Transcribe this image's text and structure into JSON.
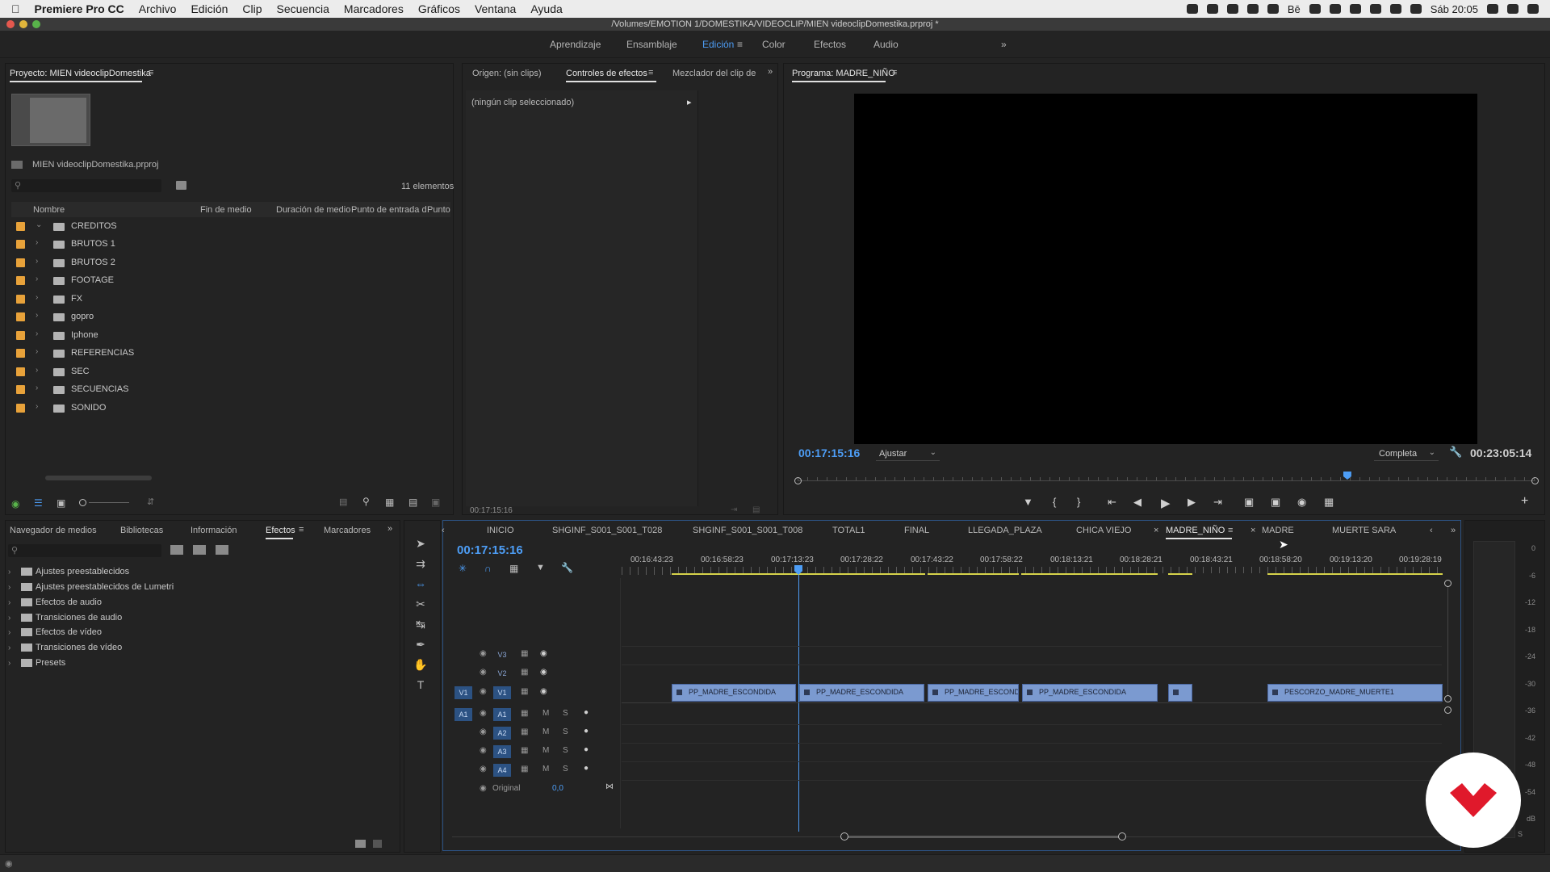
{
  "menubar": {
    "items": [
      "Premiere Pro CC",
      "Archivo",
      "Edición",
      "Clip",
      "Secuencia",
      "Marcadores",
      "Gráficos",
      "Ventana",
      "Ayuda"
    ],
    "clock": "Sáb 20:05",
    "behance": "Bē"
  },
  "window": {
    "title": "/Volumes/EMOTION 1/DOMESTIKA/VIDEOCLIP/MIEN videoclipDomestika.prproj *"
  },
  "workspaces": {
    "items": [
      "Aprendizaje",
      "Ensamblaje",
      "Edición",
      "Color",
      "Efectos",
      "Audio"
    ],
    "active": "Edición",
    "more": "»"
  },
  "project": {
    "title": "Proyecto: MIEN videoclipDomestika",
    "file": "MIEN videoclipDomestika.prproj",
    "count": "11 elementos",
    "columns": [
      "Nombre",
      "Fin de medio",
      "Duración de medio",
      "Punto de entrada d",
      "Punto"
    ],
    "folders": [
      "CREDITOS",
      "BRUTOS 1",
      "BRUTOS 2",
      "FOOTAGE",
      "FX",
      "gopro",
      "Iphone",
      "REFERENCIAS",
      "SEC",
      "SECUENCIAS",
      "SONIDO"
    ]
  },
  "source": {
    "tabs": [
      "Origen: (sin clips)",
      "Controles de efectos",
      "Mezclador del clip de"
    ],
    "message": "(ningún clip seleccionado)",
    "timecode": "00:17:15:16"
  },
  "program": {
    "title": "Programa: MADRE_NIÑO",
    "timecode": "00:17:15:16",
    "fit": "Ajustar",
    "quality": "Completa",
    "duration": "00:23:05:14",
    "playhead_fraction": 0.745
  },
  "effects_panel": {
    "tabs": [
      "Navegador de medios",
      "Bibliotecas",
      "Información",
      "Efectos",
      "Marcadores"
    ],
    "active": "Efectos",
    "items": [
      "Ajustes preestablecidos",
      "Ajustes preestablecidos de Lumetri",
      "Efectos de audio",
      "Transiciones de audio",
      "Efectos de vídeo",
      "Transiciones de vídeo",
      "Presets"
    ]
  },
  "timeline": {
    "timecode": "00:17:15:16",
    "tabs": [
      "INICIO",
      "SHGINF_S001_S001_T028",
      "SHGINF_S001_S001_T008",
      "TOTAL1",
      "FINAL",
      "LLEGADA_PLAZA",
      "CHICA VIEJO",
      "MADRE_NIÑO",
      "MADRE",
      "MUERTE SARA"
    ],
    "active_tab": "MADRE_NIÑO",
    "ruler": [
      "00:16:43:23",
      "00:16:58:23",
      "00:17:13:23",
      "00:17:28:22",
      "00:17:43:22",
      "00:17:58:22",
      "00:18:13:21",
      "00:18:28:21",
      "00:18:43:21",
      "00:18:58:20",
      "00:19:13:20",
      "00:19:28:19"
    ],
    "video_tracks": [
      "V3",
      "V2",
      "V1"
    ],
    "audio_tracks": [
      "A1",
      "A2",
      "A3",
      "A4"
    ],
    "source_patch": [
      "V1",
      "A1"
    ],
    "mute": "M",
    "solo": "S",
    "master_label": "Original",
    "master_value": "0,0",
    "clips": [
      "PP_MADRE_ESCONDIDA",
      "PP_MADRE_ESCONDIDA",
      "PP_MADRE_ESCONDI",
      "PP_MADRE_ESCONDIDA",
      "",
      "PESCORZO_MADRE_MUERTE1"
    ]
  },
  "meter": {
    "labels": [
      "0",
      "-6",
      "-12",
      "-18",
      "-24",
      "-30",
      "-36",
      "-42",
      "-48",
      "-54",
      "dB"
    ],
    "solo": "S"
  },
  "colors": {
    "accent": "#4d9df5",
    "folder": "#e8a23a",
    "clip": "#7b9ad0",
    "logo": "#e0192b"
  }
}
